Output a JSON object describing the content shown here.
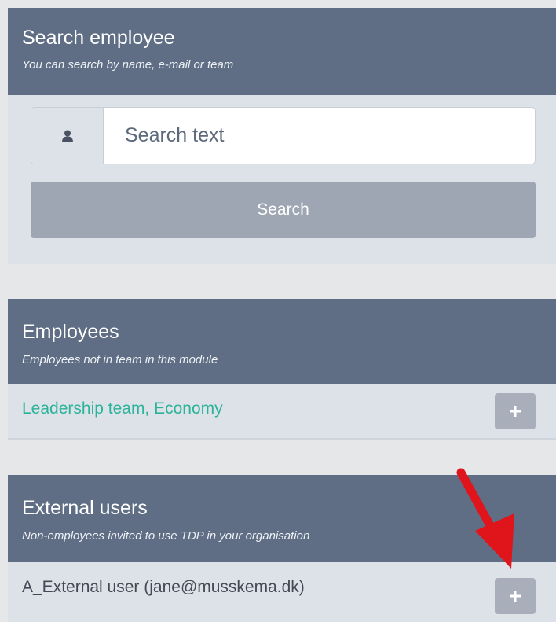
{
  "search_panel": {
    "title": "Search employee",
    "subtitle": "You can search by name, e-mail or team",
    "input_placeholder": "Search text",
    "button_label": "Search"
  },
  "employees_panel": {
    "title": "Employees",
    "subtitle": "Employees not in team in this module",
    "items": [
      {
        "label": "Leadership team, Economy"
      }
    ]
  },
  "external_panel": {
    "title": "External users",
    "subtitle": "Non-employees invited to use TDP in your organisation",
    "items": [
      {
        "label": "A_External user (jane@musskema.dk)"
      }
    ]
  },
  "icons": {
    "input_addon": "user-icon",
    "add": "plus-icon",
    "annotation": "red-arrow"
  },
  "colors": {
    "header": "#5f6e85",
    "body": "#dde2e9",
    "accent_teal": "#2bb39a",
    "arrow_red": "#e0141b"
  }
}
